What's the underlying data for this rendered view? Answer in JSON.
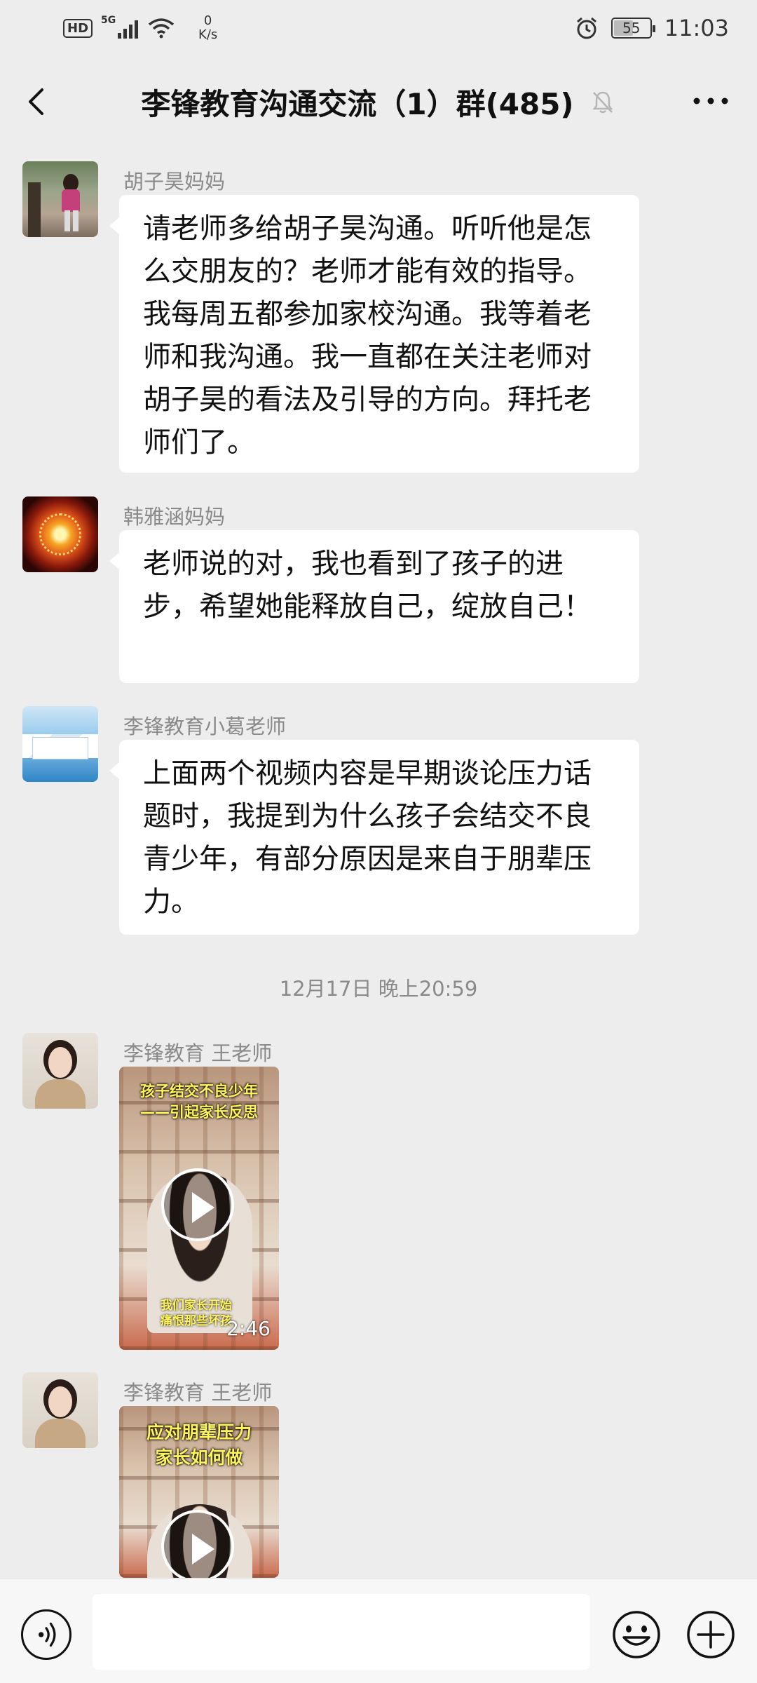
{
  "status_bar": {
    "hd": "HD",
    "network": "5G",
    "speed_value": "0",
    "speed_unit": "K/s",
    "battery": "55",
    "battery_level": 0.55,
    "time": "11:03"
  },
  "header": {
    "title": "李锋教育沟通交流（1）群(485)",
    "icons": [
      "back-arrow-icon",
      "muted-bell-icon",
      "more-dots-icon"
    ]
  },
  "messages": [
    {
      "sender": "胡子昊妈妈",
      "text": "请老师多给胡子昊沟通。听听他是怎么交朋友的？老师才能有效的指导。我每周五都参加家校沟通。我等着老师和我沟通。我一直都在关注老师对胡子昊的看法及引导的方向。拜托老师们了。"
    },
    {
      "sender": "韩雅涵妈妈",
      "text": "老师说的对，我也看到了孩子的进步，希望她能释放自己，绽放自己！"
    },
    {
      "sender": "李锋教育小葛老师",
      "text": "上面两个视频内容是早期谈论压力话题时，我提到为什么孩子会结交不良青少年，有部分原因是来自于朋辈压力。"
    }
  ],
  "timestamp": "12月17日 晚上20:59",
  "videos": [
    {
      "sender": "李锋教育 王老师",
      "caption": "孩子结交不良少年\n——引起家长反思",
      "subtitle": "我们家长开始\n痛恨那些坏孩",
      "duration": "2:46"
    },
    {
      "sender": "李锋教育 王老师",
      "caption": "应对朋辈压力\n家长如何做",
      "subtitle": "",
      "duration": ""
    }
  ],
  "input_bar": {
    "placeholder": "",
    "icons": [
      "voice-icon",
      "emoji-icon",
      "plus-icon"
    ]
  }
}
